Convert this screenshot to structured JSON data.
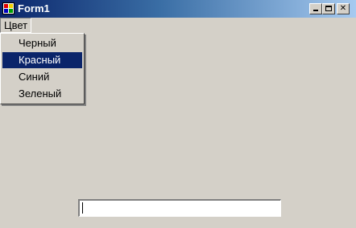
{
  "window": {
    "title": "Form1",
    "controls": [
      "minimize-icon",
      "maximize-icon",
      "close-icon"
    ],
    "close_glyph": "✕"
  },
  "menu": {
    "label": "Цвет",
    "items": [
      {
        "label": "Черный",
        "selected": false
      },
      {
        "label": "Красный",
        "selected": true
      },
      {
        "label": "Синий",
        "selected": false
      },
      {
        "label": "Зеленый",
        "selected": false
      }
    ]
  },
  "textbox": {
    "value": ""
  },
  "colors": {
    "title_gradient_start": "#0a246a",
    "title_gradient_end": "#a6caf0",
    "face": "#d4d0c8",
    "highlight": "#0a246a"
  }
}
